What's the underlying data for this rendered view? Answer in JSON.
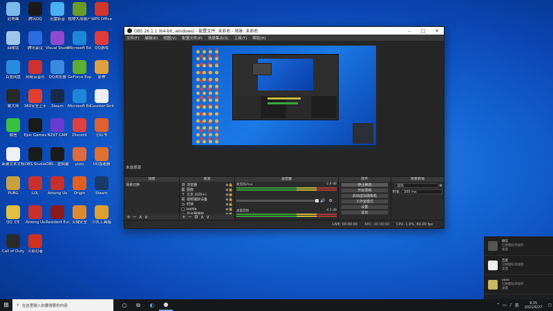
{
  "desktop_icons": [
    {
      "label": "此电脑",
      "color": "#7db9e8"
    },
    {
      "label": "腾讯QQ",
      "color": "#1a1a1a"
    },
    {
      "label": "迅雷影音",
      "color": "#4ab0f0"
    },
    {
      "label": "植物大战僵尸",
      "color": "#6a9a2a"
    },
    {
      "label": "WPS Office",
      "color": "#d0362c"
    },
    {
      "label": "回收站",
      "color": "#9fc6ea"
    },
    {
      "label": "腾讯会议",
      "color": "#2d6be0"
    },
    {
      "label": "Visual Studio",
      "color": "#8e4ad0"
    },
    {
      "label": "Microsoft Edge",
      "color": "#1e86d8"
    },
    {
      "label": "QQ游戏",
      "color": "#e03a3a"
    },
    {
      "label": "百度网盘",
      "color": "#2a8ae0"
    },
    {
      "label": "网易云音乐",
      "color": "#d03030"
    },
    {
      "label": "QQ浏览器",
      "color": "#3a8ae0"
    },
    {
      "label": "GeForce Experience",
      "color": "#5ab030"
    },
    {
      "label": "原神",
      "color": "#e0a040"
    },
    {
      "label": "鲁大师",
      "color": "#2a2a2a"
    },
    {
      "label": "360安全卫士",
      "color": "#e04030"
    },
    {
      "label": "Steam",
      "color": "#1a2a4a"
    },
    {
      "label": "Microsoft Edge",
      "color": "#1e86d8"
    },
    {
      "label": "Counter-Strike",
      "color": "#f0f0f0"
    },
    {
      "label": "微信",
      "color": "#3ac040"
    },
    {
      "label": "Epic Games",
      "color": "#1a1a1a"
    },
    {
      "label": "NZXT CAM",
      "color": "#6a3ad0"
    },
    {
      "label": "Discord",
      "color": "#e04040"
    },
    {
      "label": "小红书",
      "color": "#e06030"
    },
    {
      "label": "新建文本文档",
      "color": "#f0f0f0"
    },
    {
      "label": "OBS Studio",
      "color": "#1a1a1a"
    },
    {
      "label": "OBS - 虚拟摄像头",
      "color": "#1a1a1a"
    },
    {
      "label": "yuzu",
      "color": "#e06a40"
    },
    {
      "label": "UU加速器",
      "color": "#e07030"
    },
    {
      "label": "PUBG",
      "color": "#c8a040"
    },
    {
      "label": "LOL",
      "color": "#c83030"
    },
    {
      "label": "Among Us",
      "color": "#c8302c"
    },
    {
      "label": "Origin",
      "color": "#e06020"
    },
    {
      "label": "Steam",
      "color": "#1a3a6a"
    },
    {
      "label": "QQ飞车",
      "color": "#e0c040"
    },
    {
      "label": "Among Us",
      "color": "#c8302c"
    },
    {
      "label": "Resident Evil",
      "color": "#8a1a1a"
    },
    {
      "label": "火绒安全",
      "color": "#e08a30"
    },
    {
      "label": "小丸工具箱",
      "color": "#e0a030"
    },
    {
      "label": "Call of Duty",
      "color": "#2a2a2a"
    },
    {
      "label": "火影忍者",
      "color": "#d03020"
    }
  ],
  "obs": {
    "title": "OBS 26.1.1 (64-bit, windows) - 配置文件: 未命名 - 场景: 未命名",
    "menu": [
      "文件(F)",
      "编辑(E)",
      "视图(V)",
      "配置文件(P)",
      "场景集合(S)",
      "工具(T)",
      "帮助(H)"
    ],
    "scene_label": "未选择源",
    "panels": {
      "scenes": {
        "title": "场景",
        "items": [
          "场景切换"
        ]
      },
      "sources": {
        "title": "来源",
        "items": [
          {
            "icon": "浏",
            "name": "浏览器"
          },
          {
            "icon": "图",
            "name": "图像"
          },
          {
            "icon": "T",
            "name": "文本 (GDI+)"
          },
          {
            "icon": "视",
            "name": "视频捕获设备"
          },
          {
            "icon": "◷",
            "name": "时钟"
          },
          {
            "icon": "◯",
            "name": "bottle"
          },
          {
            "icon": "▭",
            "name": "显示器捕获"
          }
        ]
      },
      "mixer": {
        "title": "混音器",
        "channels": [
          {
            "name": "麦克风/Aux",
            "db": "-1.8 dB"
          },
          {
            "name": "桌面音频",
            "db": "-4.2 dB"
          }
        ]
      },
      "transitions": {
        "title": "场景转场",
        "type": "淡出",
        "duration_label": "时长",
        "duration": "300 ms"
      },
      "controls": {
        "title": "控件",
        "buttons": [
          "停止推流",
          "开始录制",
          "启动虚拟摄像机",
          "工作室模式",
          "设置",
          "退出"
        ]
      }
    },
    "status": {
      "live": "LIVE: 00:00:00",
      "rec": "REC: 00:00:00",
      "cpu": "CPU: 1.0%, 60.00 fps"
    }
  },
  "notifications": [
    {
      "title": "微信",
      "sub": "已将图标添加到",
      "foot": "桌面"
    },
    {
      "title": "百度",
      "sub": "已将图标添加到",
      "foot": "桌面"
    },
    {
      "title": "yuzu",
      "sub": "已将图标添加到",
      "foot": "桌面"
    }
  ],
  "taskbar": {
    "search_placeholder": "在这里输入你要搜索的内容",
    "time": "9:35",
    "date": "2021/6/27"
  }
}
